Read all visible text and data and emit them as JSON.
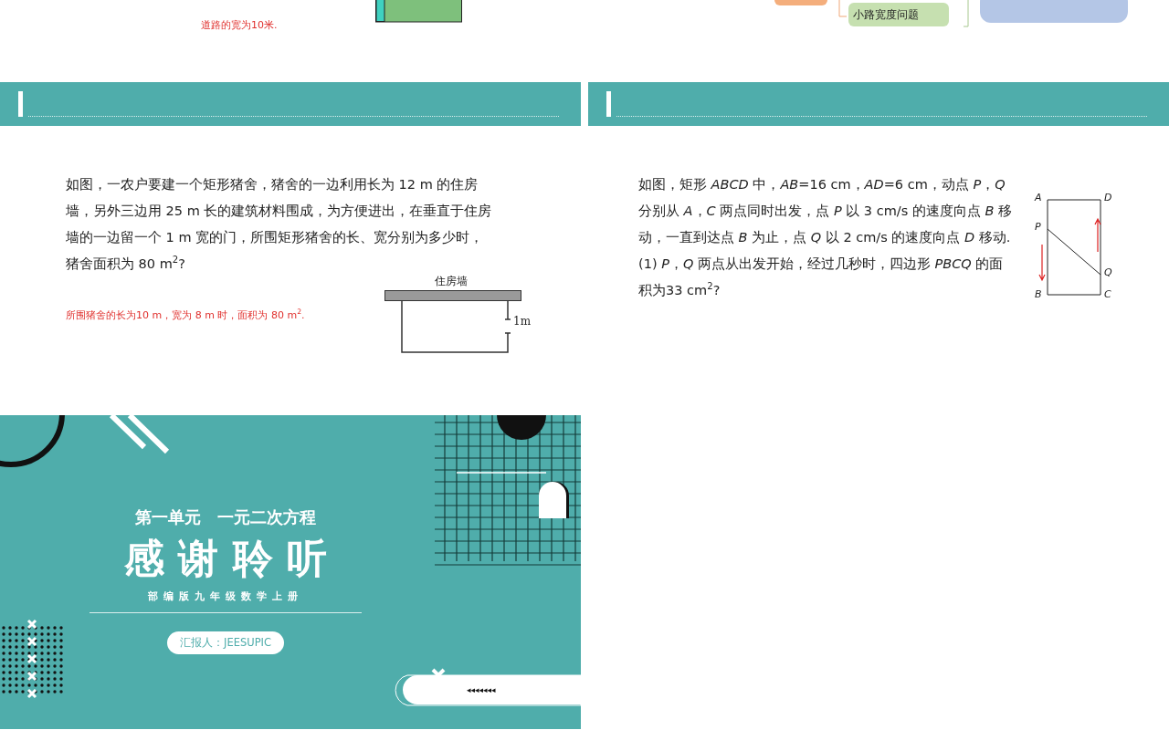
{
  "slide_road": {
    "answer": "道路的宽为10米."
  },
  "slide_mindmap": {
    "node": "小路宽度问题"
  },
  "slide_pigpen": {
    "question": "如图，一农户要建一个矩形猪舍，猪舍的一边利用长为 12 m 的住房墙，另外三边用 25 m 长的建筑材料围成，为方便进出，在垂直于住房墙的一边留一个 1 m 宽的门，所围矩形猪舍的长、宽分别为多少时，猪舍面积为 80 m$^{2}$?",
    "answer": "所围猪舍的长为10 m，宽为 8 m 时，面积为 80 m$^{2}$.",
    "wall_label": "住房墙",
    "gap_label": "1m"
  },
  "slide_rectangle": {
    "paragraphs": [
      "如图，矩形 *ABCD* 中，*AB*=16 cm，*AD*=6 cm，动点 *P*，*Q* 分别从 *A*，*C* 两点同时出发，点 *P* 以 3 cm/s 的速度向点 *B* 移动，一直到达点 *B* 为止，点 *Q* 以 2 cm/s 的速度向点 *D* 移动.",
      "(1) *P*，*Q* 两点从出发开始，经过几秒时，四边形 *PBCQ* 的面积为33 cm$^{2}$?"
    ],
    "points": [
      "A",
      "D",
      "P",
      "Q",
      "B",
      "C"
    ]
  },
  "slide_end": {
    "unit": "第一单元　一元二次方程",
    "title": "感谢聆听",
    "subtitle": "部编版九年级数学上册",
    "presenter": "汇报人：JEESUPIC",
    "arrows": "◂◂◂◂◂◂◂"
  }
}
